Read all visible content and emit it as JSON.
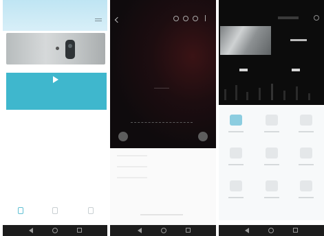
{
  "panels": [
    {
      "id": "home",
      "accent": "#3fb7cd"
    },
    {
      "id": "playback",
      "accent": "#1a0e10"
    },
    {
      "id": "device",
      "accent": "#8ccde0"
    }
  ],
  "icons": {
    "menu": "menu-icon",
    "play": "play-icon",
    "back": "back-icon",
    "gear": "gear-icon"
  },
  "colors": {
    "navbar": "#1c1c1c",
    "live_card": "#3fb7cd",
    "header_gradient": "#bfe5f3"
  }
}
